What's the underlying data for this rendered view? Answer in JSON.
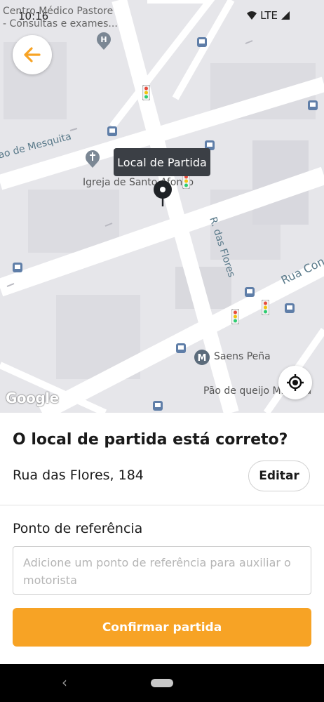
{
  "status_bar": {
    "time": "10:16",
    "network": "LTE"
  },
  "map": {
    "labels": {
      "hospital": "Centro Médico Pastore",
      "hospital_sub": "- Consultas e exames...",
      "street_left": "ao de Mesquita",
      "church": "Igreja de Santo Afonso",
      "street_flores": "R. das Flores",
      "street_right": "Rua Cond",
      "metro": "Saens Peña",
      "bakery": "Pão de queijo Mineiria"
    },
    "tooltip": "Local de Partida",
    "google": "Google"
  },
  "sheet": {
    "question": "O local de partida está correto?",
    "address": "Rua das Flores, 184",
    "edit_label": "Editar",
    "reference_label": "Ponto de referência",
    "reference_placeholder": "Adicione um ponto de referência para auxiliar o motorista",
    "confirm_label": "Confirmar partida"
  },
  "colors": {
    "accent": "#f7a325",
    "tooltip": "#3b3f45"
  },
  "icons": [
    "back-arrow-icon",
    "my-location-icon",
    "map-pin-icon",
    "hospital-icon",
    "church-icon",
    "metro-icon",
    "bus-stop-icon",
    "traffic-light-icon",
    "wifi-icon",
    "signal-icon"
  ]
}
